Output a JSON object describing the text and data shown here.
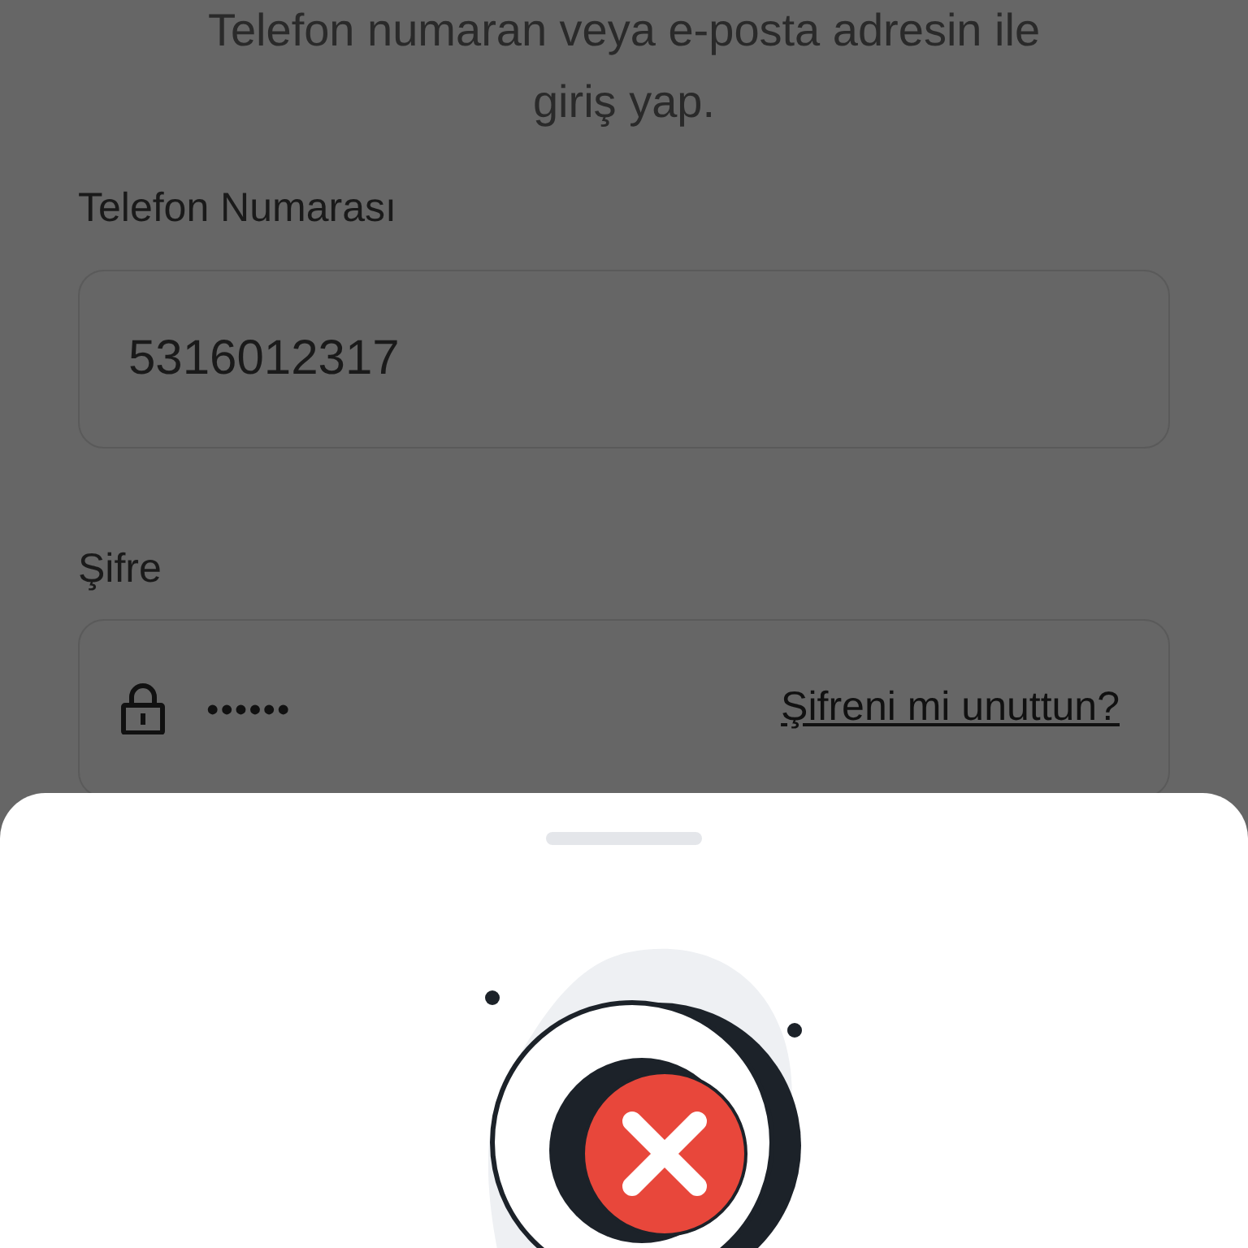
{
  "intro": {
    "lines": [
      "Telefon numaran veya e-posta adresin ile",
      "giriş yap."
    ]
  },
  "phone": {
    "label": "Telefon Numarası",
    "value": "5316012317"
  },
  "password": {
    "label": "Şifre",
    "value": "••••••",
    "forgot_link": "Şifreni mi unuttun?"
  },
  "sheet": {
    "illustration": {
      "kind": "error"
    }
  }
}
